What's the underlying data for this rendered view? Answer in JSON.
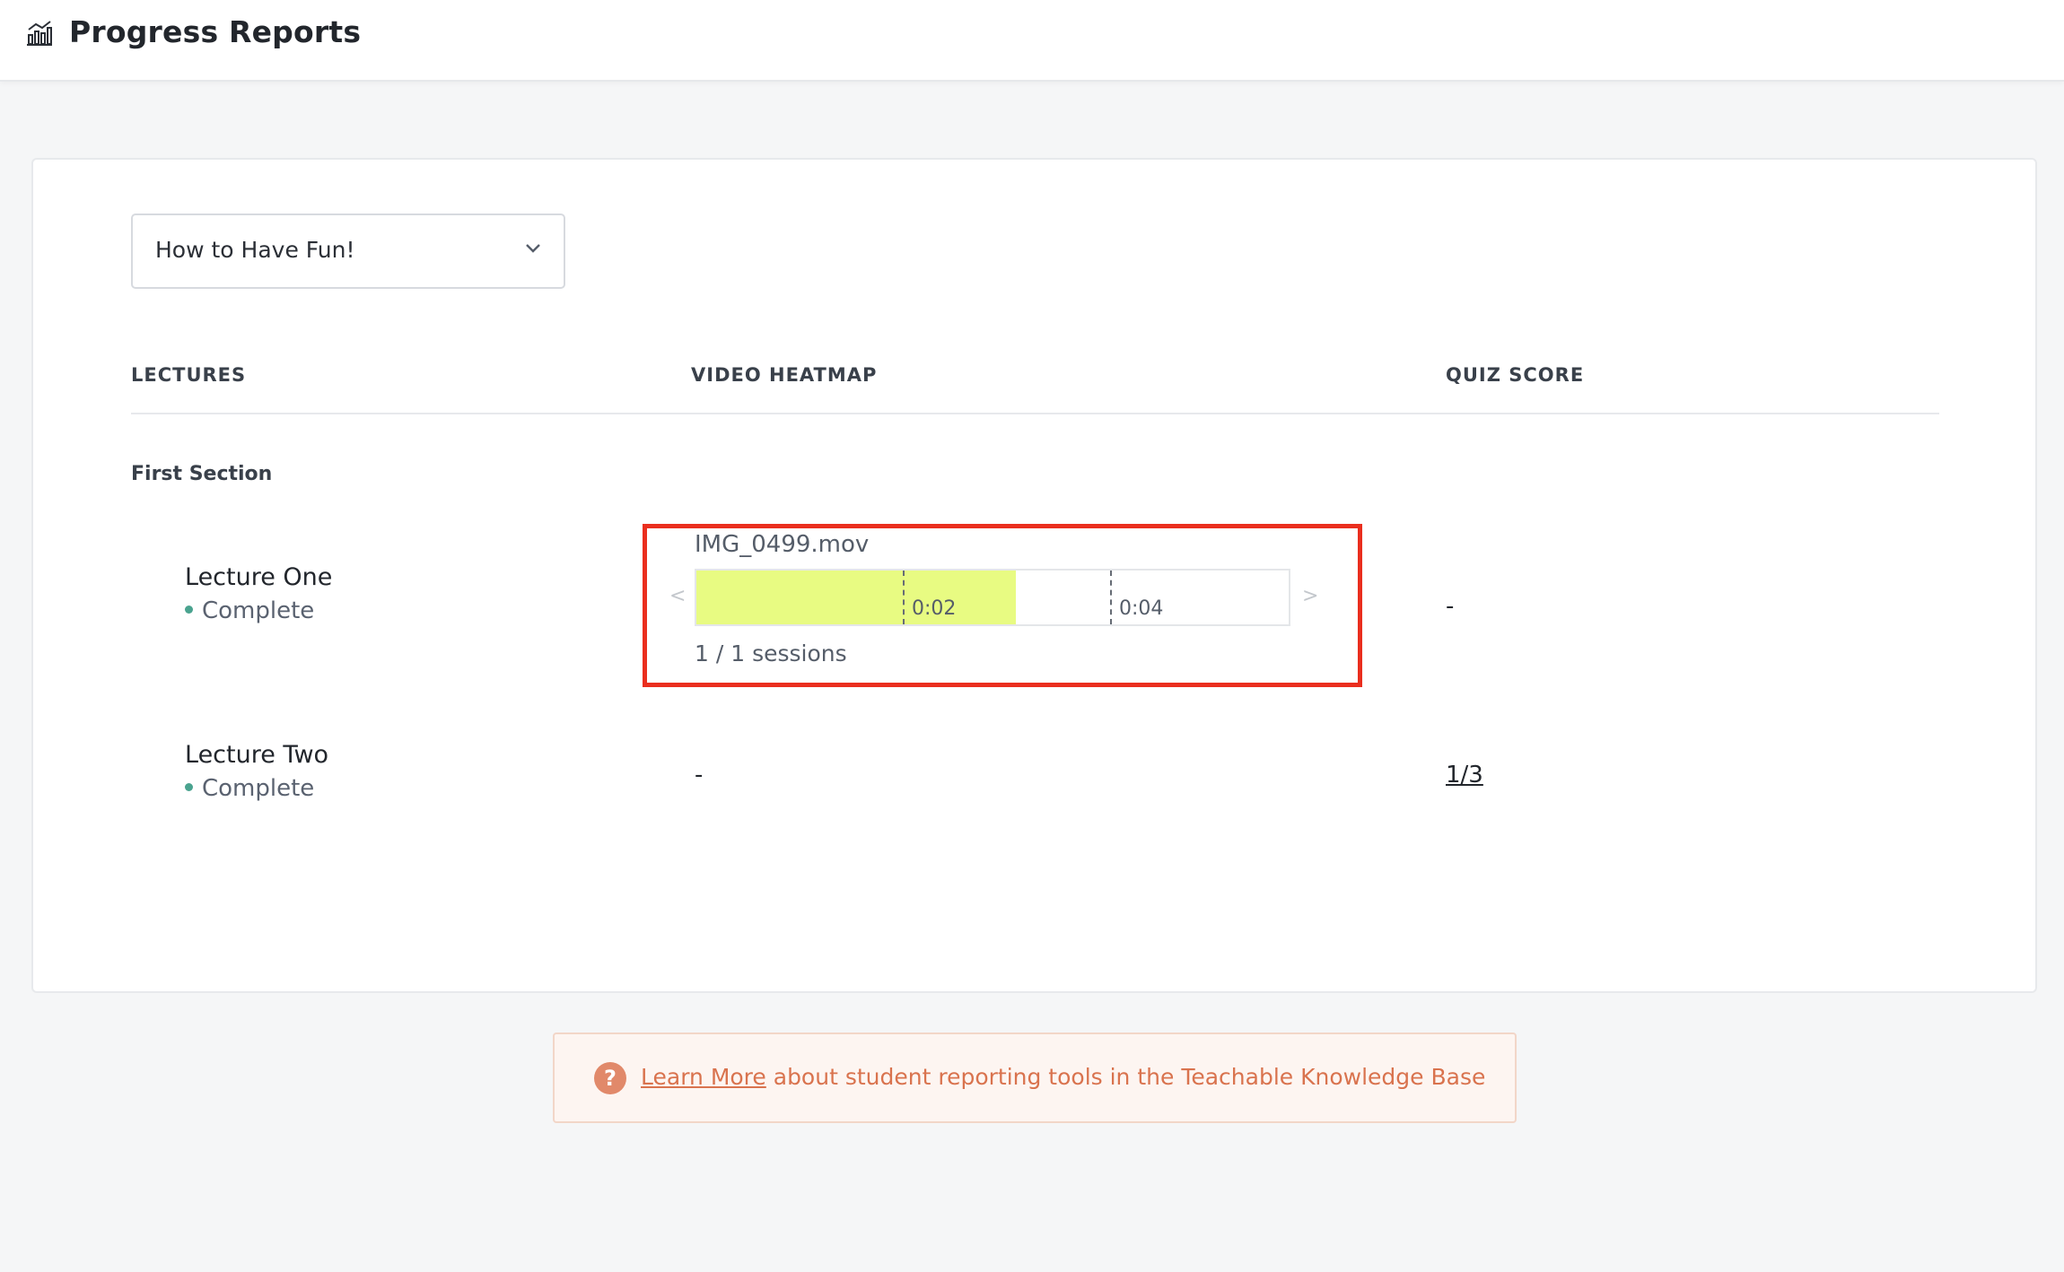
{
  "header": {
    "title": "Progress Reports",
    "icon": "bar-chart-icon"
  },
  "course_select": {
    "selected": "How to Have Fun!"
  },
  "table": {
    "columns": [
      "LECTURES",
      "VIDEO HEATMAP",
      "QUIZ SCORE"
    ],
    "sections": [
      {
        "title": "First Section",
        "lectures": [
          {
            "name": "Lecture One",
            "status": "Complete",
            "video": {
              "file": "IMG_0499.mov",
              "watched_fraction": 0.54,
              "ticks": [
                "0:02",
                "0:04"
              ],
              "sessions": "1 / 1 sessions"
            },
            "quiz_score": "-"
          },
          {
            "name": "Lecture Two",
            "status": "Complete",
            "video": "-",
            "quiz_score": "1/3"
          }
        ]
      }
    ]
  },
  "heatmap_nav": {
    "prev": "<",
    "next": ">"
  },
  "info_banner": {
    "link_text": "Learn More",
    "text": " about student reporting tools in the Teachable Knowledge Base"
  },
  "colors": {
    "heat": "#e8fb82",
    "highlight": "#ea2e1e",
    "status_dot": "#4aa38f",
    "banner_text": "#d9734e"
  }
}
